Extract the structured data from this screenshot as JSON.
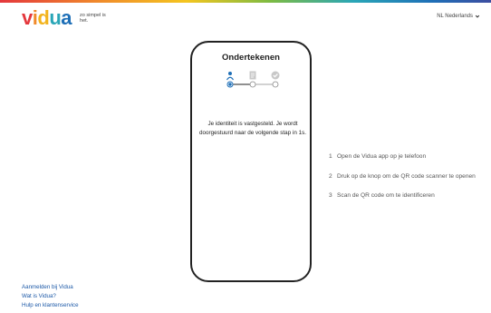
{
  "header": {
    "logo_letters": [
      "v",
      "i",
      "d",
      "u",
      "a"
    ],
    "tagline": "zo simpel is het.",
    "language": "NL Nederlands"
  },
  "phone": {
    "title": "Ondertekenen",
    "steps": [
      {
        "icon": "person-icon",
        "state": "active"
      },
      {
        "icon": "document-icon",
        "state": "inactive"
      },
      {
        "icon": "checkmark-icon",
        "state": "inactive"
      }
    ],
    "message": "Je identiteit is vastgesteld. Je wordt doorgestuurd naar de volgende stap in 1s."
  },
  "instructions": [
    {
      "number": "1",
      "text": "Open de Vidua app op je telefoon"
    },
    {
      "number": "2",
      "text": "Druk op de knop om de QR code scanner te openen"
    },
    {
      "number": "3",
      "text": "Scan de QR code om te identificeren"
    }
  ],
  "footer": {
    "links": [
      "Aanmelden bij Vidua",
      "Wat is Vidua?",
      "Hulp en klantenservice"
    ]
  },
  "colors": {
    "brand_blue": "#1e6fb7",
    "link": "#1e5aa8"
  }
}
